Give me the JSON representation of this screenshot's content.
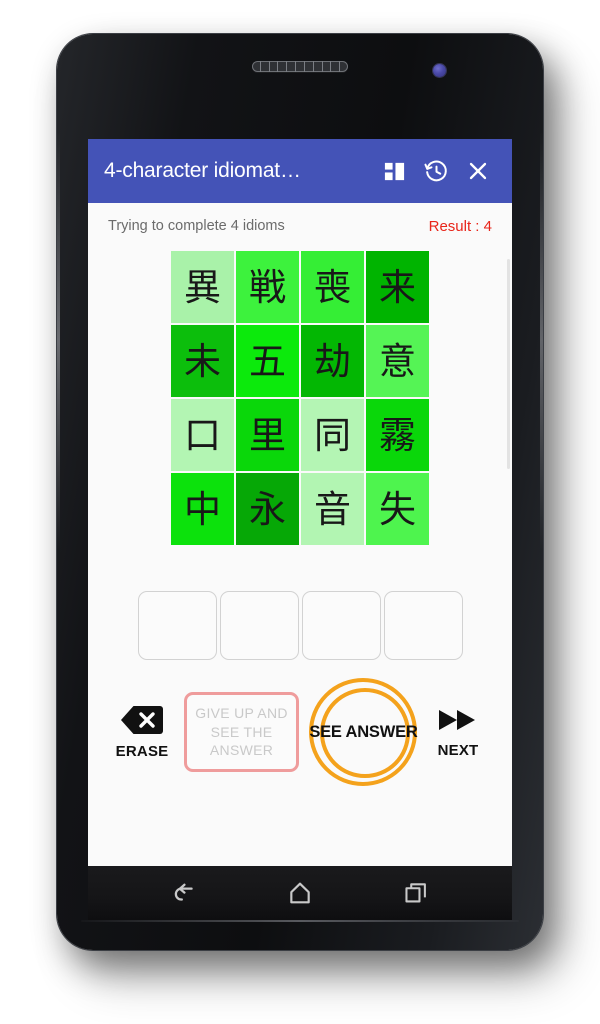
{
  "app": {
    "title": "4-character idiomat…",
    "appbar_icons": [
      {
        "name": "grid-layout-icon",
        "label": "Layout"
      },
      {
        "name": "history-icon",
        "label": "History"
      },
      {
        "name": "close-icon",
        "label": "Close"
      }
    ]
  },
  "status": {
    "message": "Trying to complete 4 idioms",
    "result_label": "Result : 4"
  },
  "grid": {
    "rows": 4,
    "cols": 4,
    "cells": [
      {
        "char": "異",
        "color": "#a9f2a9"
      },
      {
        "char": "戦",
        "color": "#3df23d"
      },
      {
        "char": "喪",
        "color": "#35ee35"
      },
      {
        "char": "来",
        "color": "#00b400"
      },
      {
        "char": "未",
        "color": "#0cbe0c"
      },
      {
        "char": "五",
        "color": "#0cea0c"
      },
      {
        "char": "劫",
        "color": "#03b703"
      },
      {
        "char": "意",
        "color": "#55f455"
      },
      {
        "char": "口",
        "color": "#b3f5b3"
      },
      {
        "char": "里",
        "color": "#0ad70a"
      },
      {
        "char": "同",
        "color": "#b4f5b4"
      },
      {
        "char": "霧",
        "color": "#0ad70a"
      },
      {
        "char": "中",
        "color": "#0ce20c"
      },
      {
        "char": "永",
        "color": "#06a806"
      },
      {
        "char": "音",
        "color": "#b2f5b2"
      },
      {
        "char": "失",
        "color": "#4ef44e"
      }
    ]
  },
  "answer_slots": [
    {
      "value": ""
    },
    {
      "value": ""
    },
    {
      "value": ""
    },
    {
      "value": ""
    }
  ],
  "actions": {
    "erase_label": "ERASE",
    "giveup_label": "GIVE UP AND SEE THE ANSWER",
    "see_answer_label": "SEE ANSWER",
    "next_label": "NEXT"
  },
  "navigation": {
    "back_label": "Back",
    "home_label": "Home",
    "recents_label": "Recent apps"
  },
  "colors": {
    "appbar": "#4453b7",
    "result": "#e8251a",
    "highlight_ring": "#f4a21c",
    "giveup_border": "#ef9c9c"
  }
}
